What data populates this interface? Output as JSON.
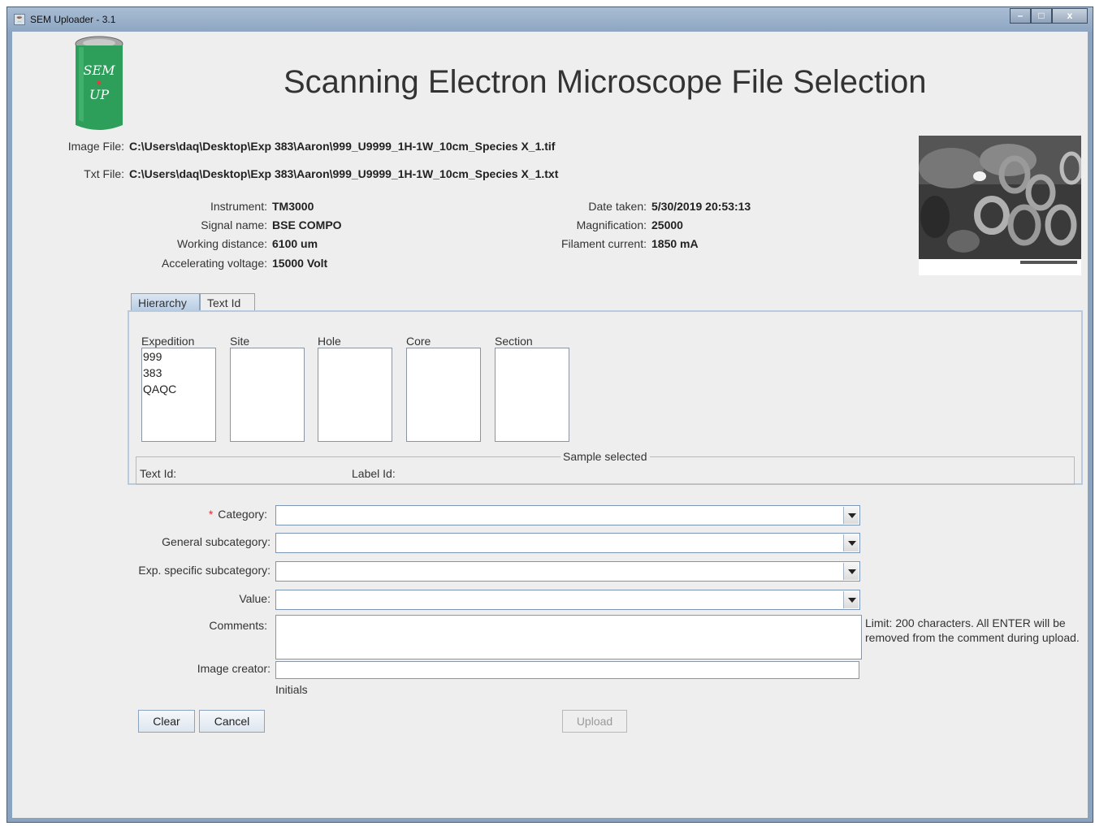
{
  "window": {
    "title": "SEM Uploader - 3.1",
    "controls": {
      "minimize": "–",
      "maximize": "□",
      "close": "x"
    }
  },
  "logo": {
    "line1": "SEM",
    "line2": "UP",
    "color": "#2e9e5b"
  },
  "header": {
    "title": "Scanning Electron Microscope File Selection"
  },
  "files": {
    "image_label": "Image File:",
    "image_value": "C:\\Users\\daq\\Desktop\\Exp 383\\Aaron\\999_U9999_1H-1W_10cm_Species X_1.tif",
    "txt_label": "Txt File:",
    "txt_value": "C:\\Users\\daq\\Desktop\\Exp 383\\Aaron\\999_U9999_1H-1W_10cm_Species X_1.txt"
  },
  "metadata": {
    "instrument_label": "Instrument:",
    "instrument_value": "TM3000",
    "signal_label": "Signal name:",
    "signal_value": "BSE COMPO",
    "working_label": "Working distance:",
    "working_value": "6100 um",
    "voltage_label": "Accelerating voltage:",
    "voltage_value": "15000 Volt",
    "date_label": "Date taken:",
    "date_value": "5/30/2019 20:53:13",
    "mag_label": "Magnification:",
    "mag_value": "25000",
    "filament_label": "Filament current:",
    "filament_value": "1850 mA"
  },
  "tabs": [
    {
      "label": "Hierarchy",
      "active": true
    },
    {
      "label": "Text Id",
      "active": false
    }
  ],
  "hierarchy": {
    "columns": [
      "Expedition",
      "Site",
      "Hole",
      "Core",
      "Section"
    ],
    "expedition_items": [
      "999",
      "383",
      "QAQC"
    ]
  },
  "sample": {
    "group_title": "Sample selected",
    "text_id_label": "Text Id:",
    "label_id_label": "Label Id:"
  },
  "form": {
    "required_mark": "*",
    "category_label": "Category:",
    "general_label": "General subcategory:",
    "exp_label": "Exp. specific subcategory:",
    "value_label": "Value:",
    "comments_label": "Comments:",
    "comments_note": "Limit: 200 characters. All ENTER will be removed from the comment during upload.",
    "creator_label": "Image creator:",
    "initials_hint": "Initials"
  },
  "buttons": {
    "clear": "Clear",
    "cancel": "Cancel",
    "upload": "Upload"
  }
}
